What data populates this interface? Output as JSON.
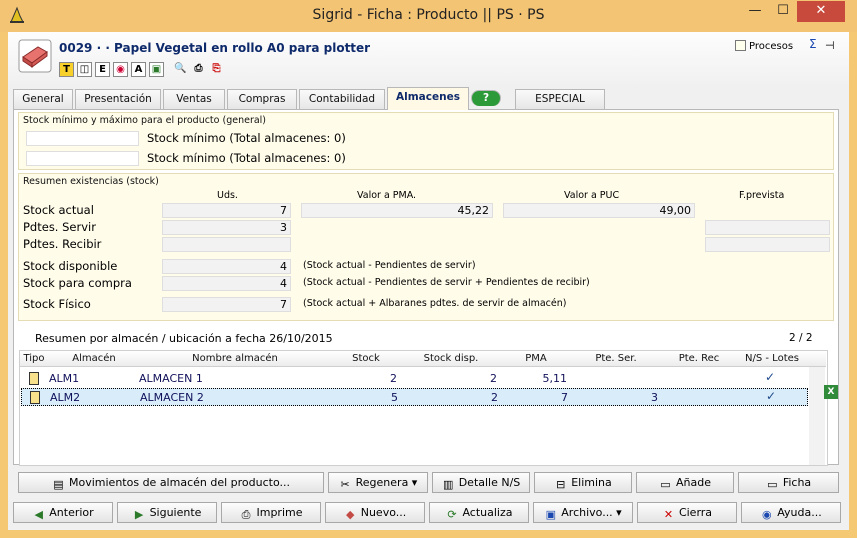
{
  "window": {
    "title": "Sigrid - Ficha : Producto || PS · PS",
    "minimize": "—",
    "maximize": "☐",
    "close": "✕"
  },
  "header": {
    "product_title": "0029 ·  · Papel Vegetal en rollo A0 para plotter",
    "procesos_label": "Procesos",
    "sigma": "Σ",
    "pin": "⊣",
    "toolbar_icons": [
      "T",
      "◫",
      "E",
      "◉",
      "A",
      "▣",
      "🔍",
      "⎙",
      "⎘"
    ]
  },
  "tabs": [
    {
      "label": "General"
    },
    {
      "label": "Presentación"
    },
    {
      "label": "Ventas"
    },
    {
      "label": "Compras"
    },
    {
      "label": "Contabilidad"
    },
    {
      "label": "Almacenes"
    },
    {
      "label": "?"
    },
    {
      "label": "ESPECIAL"
    }
  ],
  "stock_section": {
    "title": "Stock mínimo y máximo para el producto (general)",
    "row1_label": "Stock mínimo  (Total almacenes: 0)",
    "row2_label": "Stock mínimo  (Total almacenes: 0)",
    "row1_value": "",
    "row2_value": ""
  },
  "resumen": {
    "title": "Resumen existencias (stock)",
    "headers": {
      "uds": "Uds.",
      "pma": "Valor a PMA.",
      "puc": "Valor a PUC",
      "prevista": "F.prevista"
    },
    "stock_actual": {
      "label": "Stock actual",
      "uds": "7",
      "pma": "45,22",
      "puc": "49,00"
    },
    "pdtes_servir": {
      "label": "Pdtes. Servir",
      "uds": "3"
    },
    "pdtes_recibir": {
      "label": "Pdtes. Recibir",
      "uds": ""
    },
    "disponible": {
      "label": "Stock disponible",
      "uds": "4",
      "note": "(Stock actual - Pendientes de servir)"
    },
    "para_compra": {
      "label": "Stock para compra",
      "uds": "4",
      "note": "(Stock actual - Pendientes de servir + Pendientes de recibir)"
    },
    "fisico": {
      "label": "Stock Físico",
      "uds": "7",
      "note": "(Stock actual + Albaranes pdtes. de servir de almacén)"
    }
  },
  "almacen_grid": {
    "title": "Resumen por almacén / ubicación a fecha 26/10/2015",
    "pager": "2 / 2",
    "columns": [
      "Tipo",
      "Almacén",
      "Nombre almacén",
      "Stock",
      "Stock disp.",
      "PMA",
      "Pte. Ser.",
      "Pte. Rec",
      "N/S - Lotes"
    ],
    "rows": [
      {
        "almacen": "ALM1",
        "nombre": "ALMACEN 1",
        "stock": "2",
        "disp": "2",
        "pma": "5,11",
        "pte_ser": "",
        "pte_rec": "",
        "lotes": "✓"
      },
      {
        "almacen": "ALM2",
        "nombre": "ALMACEN 2",
        "stock": "5",
        "disp": "2",
        "pma": "7",
        "pte_ser": "3",
        "pte_rec": "",
        "lotes": "✓"
      }
    ]
  },
  "buttons_row1": {
    "movimientos": "Movimientos de almacén del producto...",
    "regenera": "Regenera",
    "detalle": "Detalle N/S",
    "elimina": "Elimina",
    "anade": "Añade",
    "ficha": "Ficha"
  },
  "buttons_row2": {
    "anterior": "Anterior",
    "siguiente": "Siguiente",
    "imprime": "Imprime",
    "nuevo": "Nuevo...",
    "actualiza": "Actualiza",
    "archivo": "Archivo...",
    "cierra": "Cierra",
    "ayuda": "Ayuda..."
  }
}
